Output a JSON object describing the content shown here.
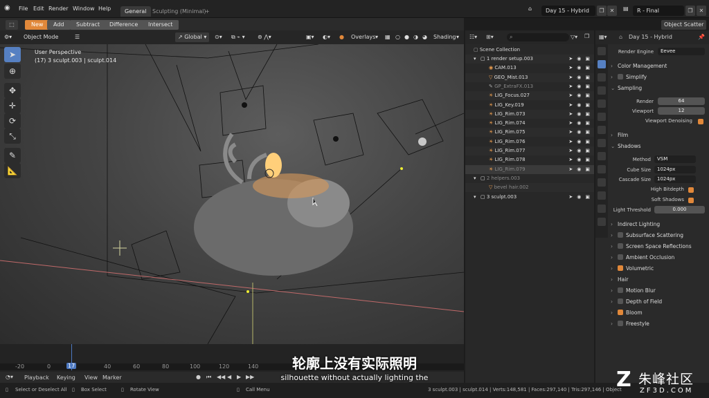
{
  "topbar": {
    "menus": [
      "File",
      "Edit",
      "Render",
      "Window",
      "Help"
    ],
    "workspaces": [
      "General",
      "Sculpting (Minimal)"
    ],
    "add_tab": "+",
    "scene": "Day 15 - Hybrid",
    "view_layer": "R - Final"
  },
  "toolbar2": {
    "modes": [
      "New",
      "Add",
      "Subtract",
      "Difference",
      "Intersect"
    ],
    "object_scatter": "Object Scatter"
  },
  "header3d": {
    "mode": "Object Mode",
    "orientation": "Global",
    "overlays": "Overlays",
    "shading": "Shading"
  },
  "viewport": {
    "line1": "User Perspective",
    "line2": "(17) 3 sculpt.003 | sculpt.014"
  },
  "timeline": {
    "ticks": [
      "-20",
      "0",
      "17",
      "40",
      "60",
      "80",
      "100",
      "120",
      "140"
    ],
    "current_frame": "17",
    "menus": [
      "Playback",
      "Keying",
      "View",
      "Marker"
    ]
  },
  "outliner": {
    "search_placeholder": "",
    "root": "Scene Collection",
    "rows": [
      {
        "name": "1 render setup.003",
        "indent": 1,
        "type": "collection"
      },
      {
        "name": "CAM.013",
        "indent": 2,
        "type": "camera"
      },
      {
        "name": "GEO_Mist.013",
        "indent": 2,
        "type": "mesh"
      },
      {
        "name": "GP_ExtraFX.013",
        "indent": 2,
        "type": "gp"
      },
      {
        "name": "LIG_Focus.027",
        "indent": 2,
        "type": "light"
      },
      {
        "name": "LIG_Key.019",
        "indent": 2,
        "type": "light"
      },
      {
        "name": "LIG_Rim.073",
        "indent": 2,
        "type": "light"
      },
      {
        "name": "LIG_Rim.074",
        "indent": 2,
        "type": "light"
      },
      {
        "name": "LIG_Rim.075",
        "indent": 2,
        "type": "light"
      },
      {
        "name": "LIG_Rim.076",
        "indent": 2,
        "type": "light"
      },
      {
        "name": "LIG_Rim.077",
        "indent": 2,
        "type": "light"
      },
      {
        "name": "LIG_Rim.078",
        "indent": 2,
        "type": "light"
      },
      {
        "name": "LIG_Rim.079",
        "indent": 2,
        "type": "light"
      },
      {
        "name": "2 helpers.003",
        "indent": 1,
        "type": "collection"
      },
      {
        "name": "bevel hair.002",
        "indent": 2,
        "type": "mesh"
      },
      {
        "name": "3 sculpt.003",
        "indent": 1,
        "type": "collection"
      }
    ]
  },
  "properties": {
    "title": "Day 15 - Hybrid",
    "render_engine_label": "Render Engine",
    "render_engine": "Eevee",
    "sections_top": [
      "Color Management",
      "Simplify",
      "Sampling"
    ],
    "render_label": "Render",
    "render_value": "64",
    "viewport_label": "Viewport",
    "viewport_value": "12",
    "viewport_denoising": "Viewport Denoising",
    "film": "Film",
    "shadows": "Shadows",
    "method_label": "Method",
    "method": "VSM",
    "cube_label": "Cube Size",
    "cube": "1024px",
    "cascade_label": "Cascade Size",
    "cascade": "1024px",
    "high_bitdepth": "High Bitdepth",
    "soft_shadows": "Soft Shadows",
    "light_threshold_label": "Light Threshold",
    "light_threshold": "0.000",
    "sections_bottom": [
      {
        "label": "Indirect Lighting",
        "check": null
      },
      {
        "label": "Subsurface Scattering",
        "check": false
      },
      {
        "label": "Screen Space Reflections",
        "check": false
      },
      {
        "label": "Ambient Occlusion",
        "check": false
      },
      {
        "label": "Volumetric",
        "check": true
      },
      {
        "label": "Hair",
        "check": null
      },
      {
        "label": "Motion Blur",
        "check": false
      },
      {
        "label": "Depth of Field",
        "check": false
      },
      {
        "label": "Bloom",
        "check": true
      },
      {
        "label": "Freestyle",
        "check": false
      }
    ]
  },
  "status": {
    "left": [
      "Select or Deselect All",
      "Box Select",
      "Rotate View",
      "Call Menu"
    ],
    "right": "3 sculpt.003 | sculpt.014 | Verts:148,581 | Faces:297,140 | Tris:297,146 | Objects:1/1"
  },
  "subtitle": {
    "cn": "轮廓上没有实际照明",
    "en": "silhouette without actually lighting the"
  },
  "watermark": {
    "cn": "朱峰社区",
    "url": "ZF3D.COM"
  },
  "colors": {
    "accent": "#e1883a",
    "select": "#5680c2"
  }
}
